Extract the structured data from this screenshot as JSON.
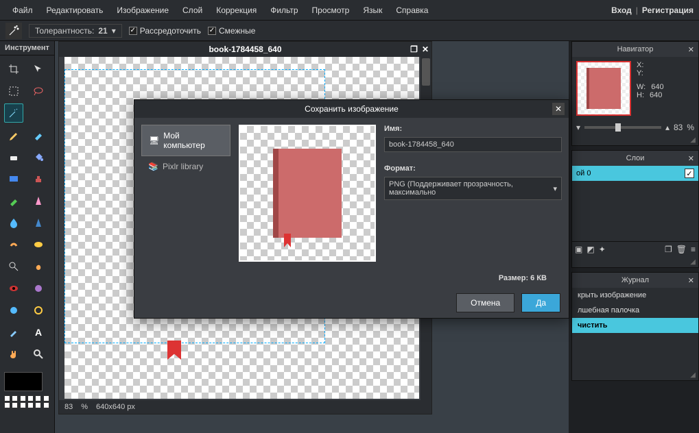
{
  "menu": {
    "items": [
      "Файл",
      "Редактировать",
      "Изображение",
      "Слой",
      "Коррекция",
      "Фильтр",
      "Просмотр",
      "Язык",
      "Справка"
    ],
    "login": "Вход",
    "register": "Регистрация"
  },
  "toolbar": {
    "tolerance_label": "Толерантность:",
    "tolerance_value": "21",
    "opt1": "Рассредоточить",
    "opt2": "Смежные"
  },
  "tools_title": "Инструмент",
  "document": {
    "title": "book-1784458_640",
    "zoom": "83",
    "zoom_unit": "%",
    "dims": "640x640 px"
  },
  "navigator": {
    "title": "Навигатор",
    "x_label": "X:",
    "y_label": "Y:",
    "w_label": "W:",
    "h_label": "H:",
    "w": "640",
    "h": "640",
    "zoom": "83",
    "zoom_unit": "%"
  },
  "layers": {
    "title": "Слои",
    "layer0": "ой 0"
  },
  "history": {
    "title": "Журнал",
    "items": [
      "крыть изображение",
      "лшебная палочка",
      "чистить"
    ]
  },
  "dialog": {
    "title": "Сохранить изображение",
    "side_mycomputer": "Мой компьютер",
    "side_library": "Pixlr library",
    "name_label": "Имя:",
    "name_value": "book-1784458_640",
    "format_label": "Формат:",
    "format_value": "PNG (Поддерживает прозрачность, максимально",
    "size_label": "Размер: 6 КВ",
    "cancel": "Отмена",
    "ok": "Да"
  }
}
